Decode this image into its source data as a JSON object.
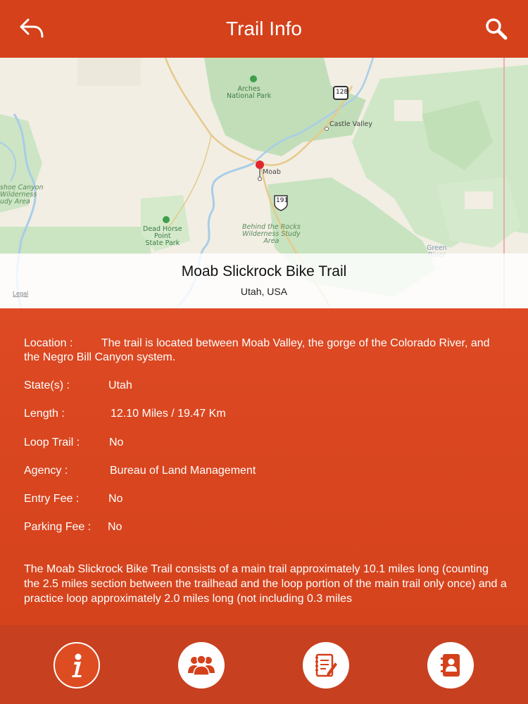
{
  "header": {
    "title": "Trail Info",
    "back_icon": "back-arrow-icon",
    "search_icon": "search-icon"
  },
  "map": {
    "labels": {
      "arches": "Arches\nNational Park",
      "castle_valley": "Castle Valley",
      "moab": "Moab",
      "route_128": "128",
      "route_191": "191",
      "dead_horse": "Dead Horse\nPoint\nState Park",
      "behind_rocks": "Behind the Rocks\nWilderness Study\nArea",
      "horseshoe": "shoe Canyon\nWilderness\nudy Area",
      "green_river": "Green\nRiver",
      "legal": "Legal"
    },
    "trail_name": "Moab Slickrock Bike Trail",
    "region": "Utah, USA"
  },
  "details": {
    "location_label": "Location  :",
    "location_value": "The trail is located between Moab Valley, the gorge of the Colorado River, and the Negro Bill Canyon system.",
    "state_label": "State(s)  :",
    "state_value": "Utah",
    "length_label": "Length  :",
    "length_value": "12.10 Miles / 19.47 Km",
    "loop_label": "Loop Trail  :",
    "loop_value": "No",
    "agency_label": "Agency  :",
    "agency_value": "Bureau of Land Management",
    "entry_label": "Entry Fee  :",
    "entry_value": "No",
    "parking_label": "Parking Fee  :",
    "parking_value": "No",
    "description": "The Moab Slickrock Bike Trail consists of a main trail approximately 10.1 miles long (counting the 2.5 miles section between the trailhead and the loop portion of the main trail only once) and a practice loop approximately 2.0 miles long (not including 0.3 miles"
  },
  "bottom_nav": {
    "items": [
      {
        "icon": "info-icon",
        "active": true
      },
      {
        "icon": "group-icon",
        "active": false
      },
      {
        "icon": "notes-icon",
        "active": false
      },
      {
        "icon": "contact-book-icon",
        "active": false
      }
    ]
  },
  "colors": {
    "header": "#d4411b",
    "content": "#d9461f",
    "bottom_bar": "#c7401f"
  }
}
